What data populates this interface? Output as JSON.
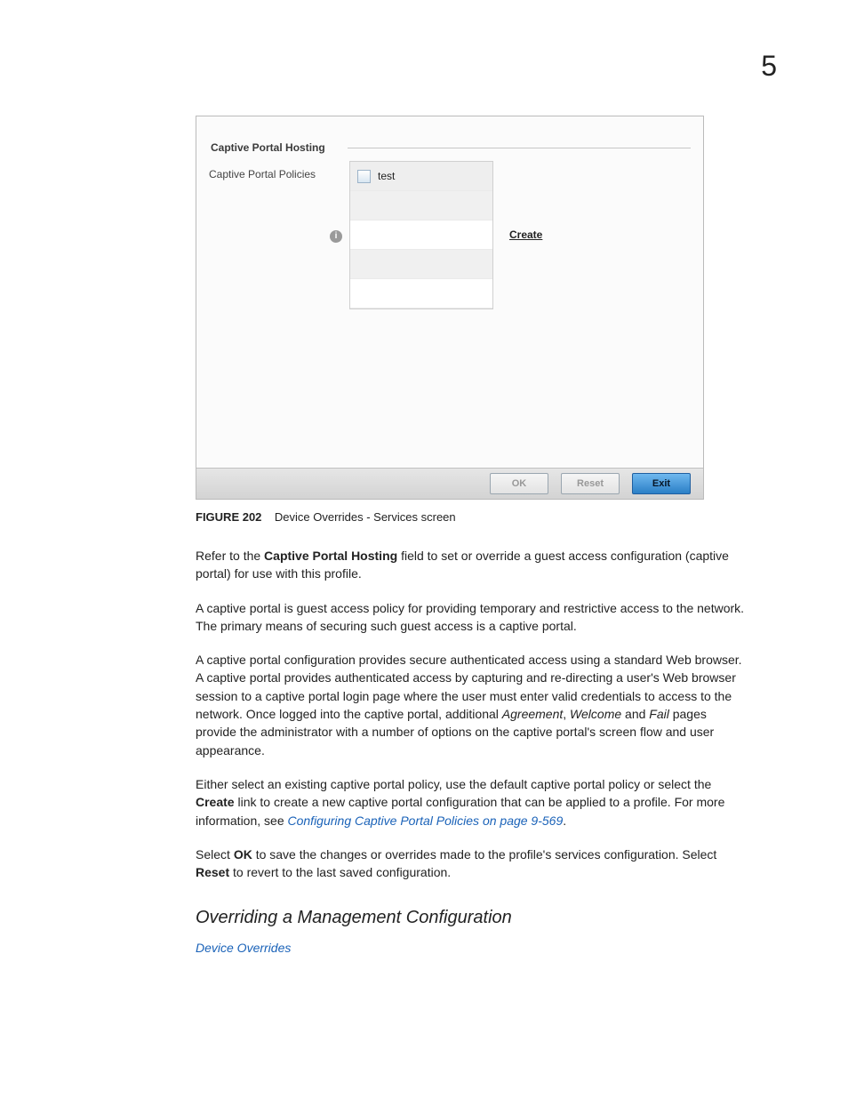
{
  "page_number": "5",
  "figure": {
    "group_legend": "Captive Portal Hosting",
    "field_label": "Captive Portal Policies",
    "list_item": "test",
    "create_link": "Create",
    "buttons": {
      "ok": "OK",
      "reset": "Reset",
      "exit": "Exit"
    }
  },
  "caption": {
    "label": "FIGURE 202",
    "text": "Device Overrides - Services screen"
  },
  "paragraphs": {
    "p1a": "Refer to the ",
    "p1b": "Captive Portal Hosting",
    "p1c": " field to set or override a guest access configuration (captive portal) for use with this profile.",
    "p2": "A captive portal is guest access policy for providing temporary and restrictive access to the network. The primary means of securing such guest access is a captive portal.",
    "p3a": "A captive portal configuration provides secure authenticated access using a standard Web browser. A captive portal provides authenticated access by capturing and re-directing a user's Web browser session to a captive portal login page where the user must enter valid credentials to access to the network. Once logged into the captive portal, additional ",
    "p3_i1": "Agreement",
    "p3_s1": ", ",
    "p3_i2": "Welcome",
    "p3_s2": " and ",
    "p3_i3": "Fail",
    "p3b": " pages provide the administrator with a number of options on the captive portal's screen flow and user appearance.",
    "p4a": "Either select an existing captive portal policy, use the default captive portal policy or select the ",
    "p4b": "Create",
    "p4c": " link to create a new captive portal configuration that can be applied to a profile. For more information, see ",
    "p4_link": "Configuring Captive Portal Policies on page 9-569",
    "p4d": ".",
    "p5a": "Select ",
    "p5b": "OK",
    "p5c": " to save the changes or overrides made to the profile's services configuration. Select ",
    "p5d": "Reset",
    "p5e": " to revert to the last saved configuration."
  },
  "subheading": "Overriding a Management Configuration",
  "sublink": "Device Overrides"
}
